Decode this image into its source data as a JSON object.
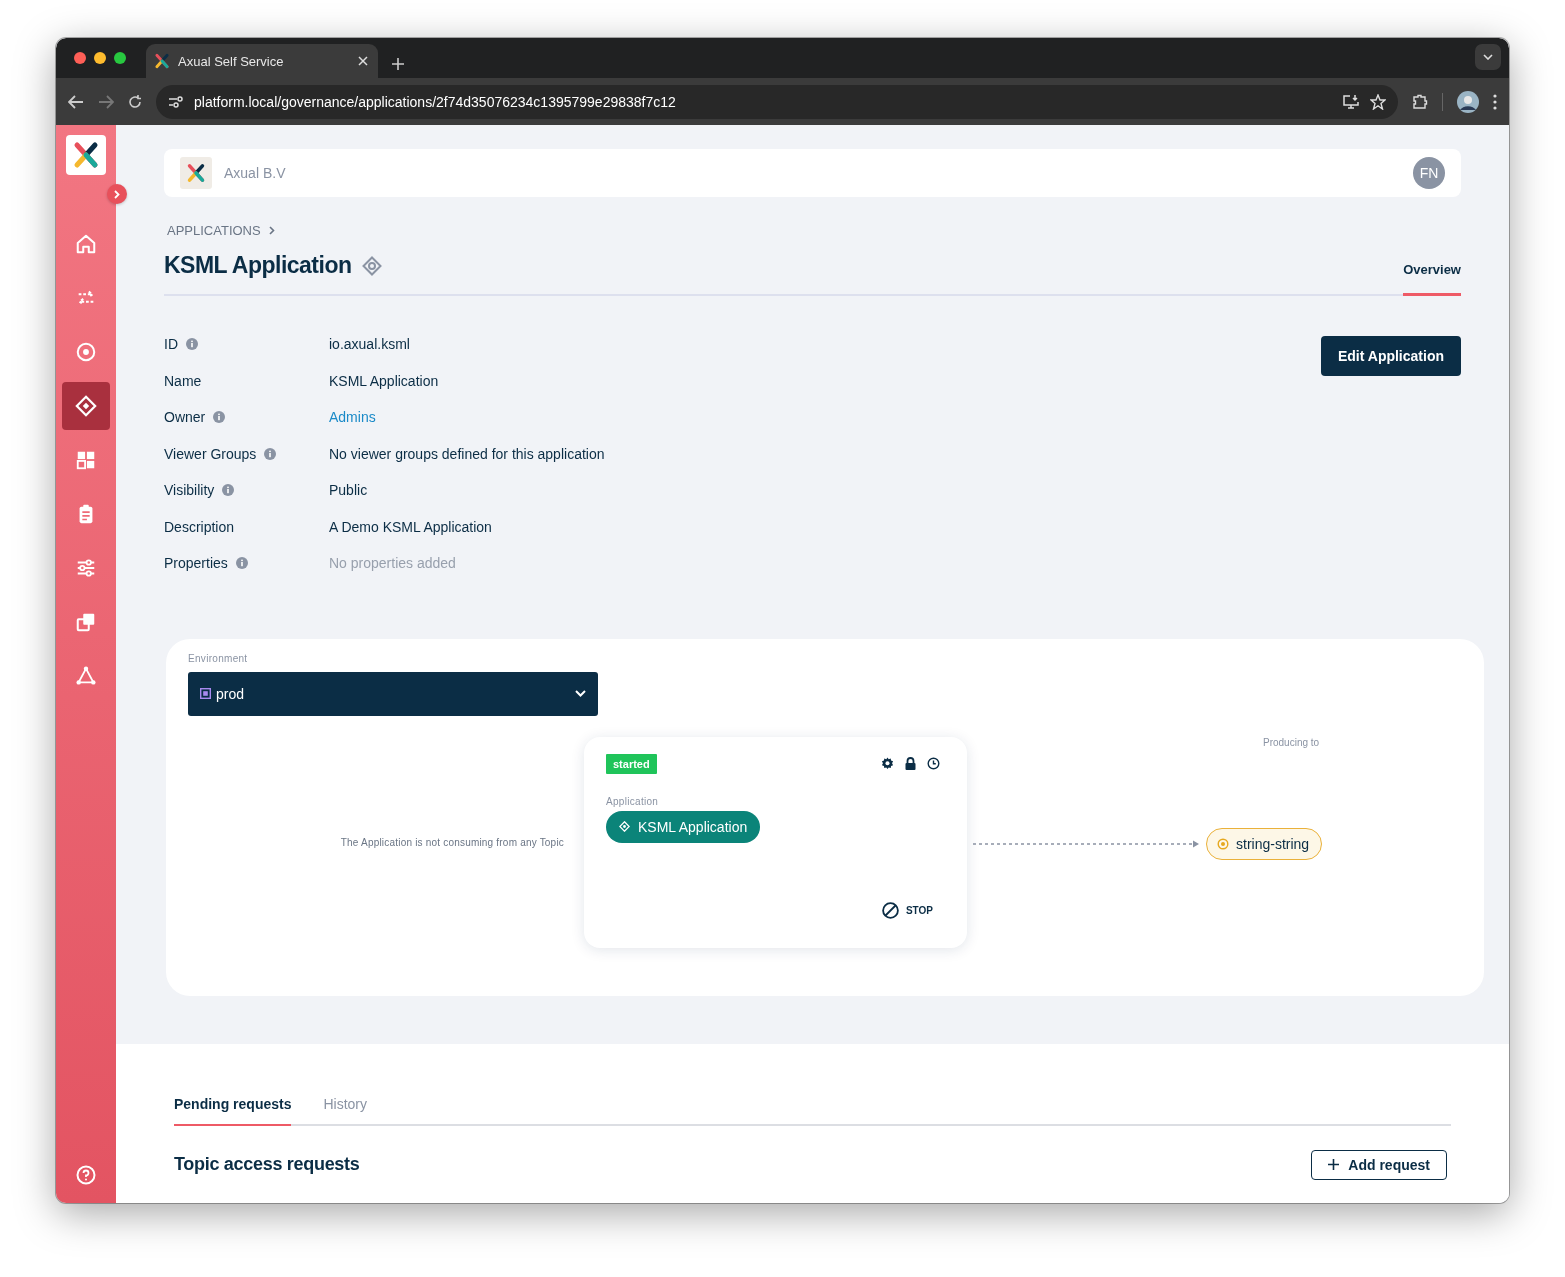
{
  "browser": {
    "tab_title": "Axual Self Service",
    "url": "platform.local/governance/applications/2f74d35076234c1395799e29838f7c12"
  },
  "sidebar": {
    "items": [
      {
        "selected": false
      },
      {
        "selected": false
      },
      {
        "selected": false
      },
      {
        "selected": true
      },
      {
        "selected": false
      },
      {
        "selected": false
      },
      {
        "selected": false
      },
      {
        "selected": false
      },
      {
        "selected": false
      }
    ]
  },
  "header": {
    "org": "Axual B.V",
    "avatar": "FN"
  },
  "breadcrumb": "APPLICATIONS",
  "title": "KSML Application",
  "tabs": [
    {
      "label": "Overview",
      "selected": true
    }
  ],
  "edit_button": "Edit Application",
  "details": [
    {
      "label": "ID",
      "info": true,
      "value": "io.axual.ksml",
      "kind": "text"
    },
    {
      "label": "Name",
      "info": false,
      "value": "KSML Application",
      "kind": "text"
    },
    {
      "label": "Owner",
      "info": true,
      "value": "Admins",
      "kind": "link"
    },
    {
      "label": "Viewer Groups",
      "info": true,
      "value": "No viewer groups defined for this application",
      "kind": "text"
    },
    {
      "label": "Visibility",
      "info": true,
      "value": "Public",
      "kind": "text"
    },
    {
      "label": "Description",
      "info": false,
      "value": "A Demo KSML Application",
      "kind": "text"
    },
    {
      "label": "Properties",
      "info": true,
      "value": "No properties added",
      "kind": "muted"
    }
  ],
  "environment": {
    "label": "Environment",
    "value": "prod"
  },
  "topology": {
    "consuming_note": "The Application is not consuming from any Topic",
    "status": "started",
    "node_label": "Application",
    "app_name": "KSML Application",
    "stop_label": "STOP",
    "producing_label": "Producing to",
    "topics": [
      {
        "name": "string-string"
      }
    ]
  },
  "requests": {
    "tabs": [
      {
        "label": "Pending requests",
        "selected": true
      },
      {
        "label": "History",
        "selected": false
      }
    ],
    "title": "Topic access requests",
    "add_button": "Add request"
  }
}
